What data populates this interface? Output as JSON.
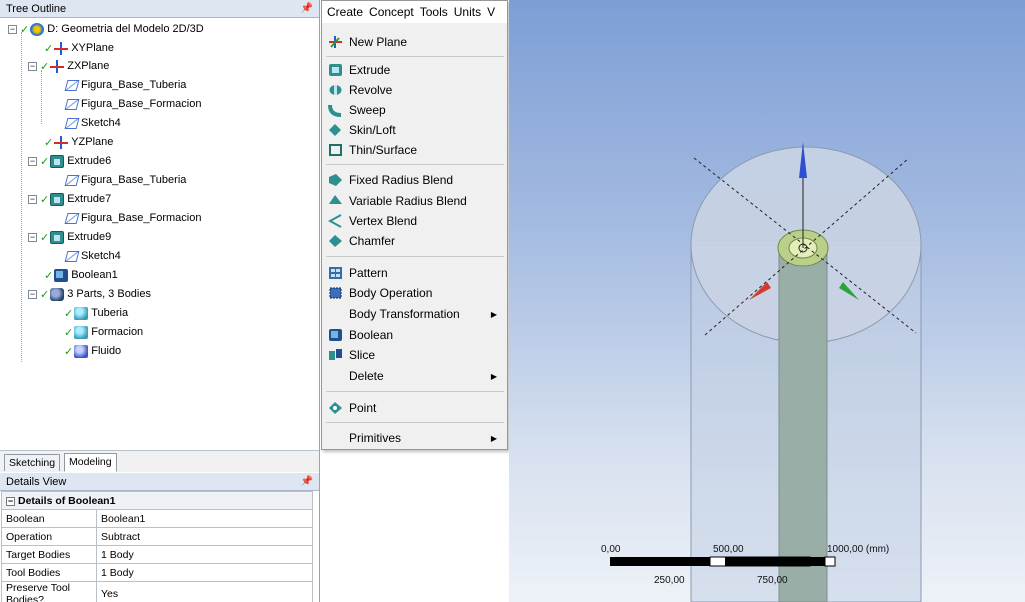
{
  "tree_outline": {
    "title": "Tree Outline",
    "items": [
      {
        "label": "D: Geometria del Modelo 2D/3D"
      },
      {
        "label": "XYPlane"
      },
      {
        "label": "ZXPlane"
      },
      {
        "label": "Figura_Base_Tuberia"
      },
      {
        "label": "Figura_Base_Formacion"
      },
      {
        "label": "Sketch4"
      },
      {
        "label": "YZPlane"
      },
      {
        "label": "Extrude6"
      },
      {
        "label": "Figura_Base_Tuberia"
      },
      {
        "label": "Extrude7"
      },
      {
        "label": "Figura_Base_Formacion"
      },
      {
        "label": "Extrude9"
      },
      {
        "label": "Sketch4"
      },
      {
        "label": "Boolean1"
      },
      {
        "label": "3 Parts, 3 Bodies"
      },
      {
        "label": "Tuberia"
      },
      {
        "label": "Formacion"
      },
      {
        "label": "Fluido"
      }
    ]
  },
  "tabs": {
    "sketching": "Sketching",
    "modeling": "Modeling"
  },
  "details": {
    "title": "Details View",
    "group": "Details of Boolean1",
    "rows": [
      {
        "k": "Boolean",
        "v": "Boolean1"
      },
      {
        "k": "Operation",
        "v": "Subtract"
      },
      {
        "k": "Target Bodies",
        "v": "1 Body"
      },
      {
        "k": "Tool Bodies",
        "v": "1 Body"
      },
      {
        "k": "Preserve Tool Bodies?",
        "v": "Yes"
      }
    ]
  },
  "menubar": [
    "Create",
    "Concept",
    "Tools",
    "Units",
    "V"
  ],
  "menu": {
    "items": [
      {
        "label": "New Plane",
        "icon": "new-plane-icon"
      },
      {
        "label": "Extrude",
        "icon": "extrude-icon"
      },
      {
        "label": "Revolve",
        "icon": "revolve-icon"
      },
      {
        "label": "Sweep",
        "icon": "sweep-icon"
      },
      {
        "label": "Skin/Loft",
        "icon": "skin-loft-icon"
      },
      {
        "label": "Thin/Surface",
        "icon": "thin-surface-icon"
      },
      {
        "label": "Fixed Radius Blend",
        "icon": "fixed-radius-blend-icon"
      },
      {
        "label": "Variable Radius Blend",
        "icon": "variable-radius-blend-icon"
      },
      {
        "label": "Vertex Blend",
        "icon": "vertex-blend-icon"
      },
      {
        "label": "Chamfer",
        "icon": "chamfer-icon"
      },
      {
        "label": "Pattern",
        "icon": "pattern-icon"
      },
      {
        "label": "Body Operation",
        "icon": "body-operation-icon"
      },
      {
        "label": "Body Transformation"
      },
      {
        "label": "Boolean",
        "icon": "boolean-icon"
      },
      {
        "label": "Slice",
        "icon": "slice-icon"
      },
      {
        "label": "Delete"
      },
      {
        "label": "Point",
        "icon": "point-icon"
      },
      {
        "label": "Primitives"
      }
    ]
  },
  "scale": {
    "top": [
      "0,00",
      "500,00",
      "1000,00 (mm)"
    ],
    "bottom": [
      "250,00",
      "750,00"
    ]
  }
}
